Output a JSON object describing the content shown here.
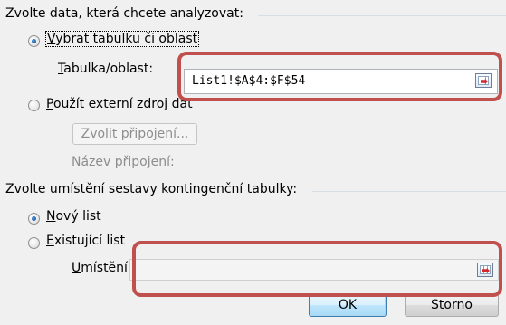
{
  "source_section": {
    "heading": "Zvolte data, která chcete analyzovat:",
    "option_table": {
      "label_prefix": "V",
      "label_rest": "ybrat tabulku či oblast",
      "selected": true
    },
    "table_range": {
      "label_prefix": "T",
      "label_rest": "abulka/oblast:",
      "value": "List1!$A$4:$F$54",
      "ref_button_icon": "range-select-icon"
    },
    "option_external": {
      "label_prefix": "P",
      "label_rest": "oužít externí zdroj dat",
      "selected": false
    },
    "choose_connection_button": "Zvolit připojení...",
    "connection_name_label": "Název připojení:"
  },
  "destination_section": {
    "heading": "Zvolte umístění sestavy kontingenční tabulky:",
    "option_new_sheet": {
      "label_prefix": "N",
      "label_rest": "ový list",
      "selected": true
    },
    "option_existing_sheet": {
      "label_prefix": "E",
      "label_rest": "xistující list",
      "selected": false
    },
    "location": {
      "label_prefix": "U",
      "label_rest": "místění:",
      "value": "",
      "ref_button_icon": "range-select-icon"
    }
  },
  "buttons": {
    "ok": "OK",
    "cancel": "Storno"
  },
  "colors": {
    "highlight": "#c0504d",
    "dialog_background": "#f0f0f0",
    "disabled_text": "#8d8d8d"
  }
}
